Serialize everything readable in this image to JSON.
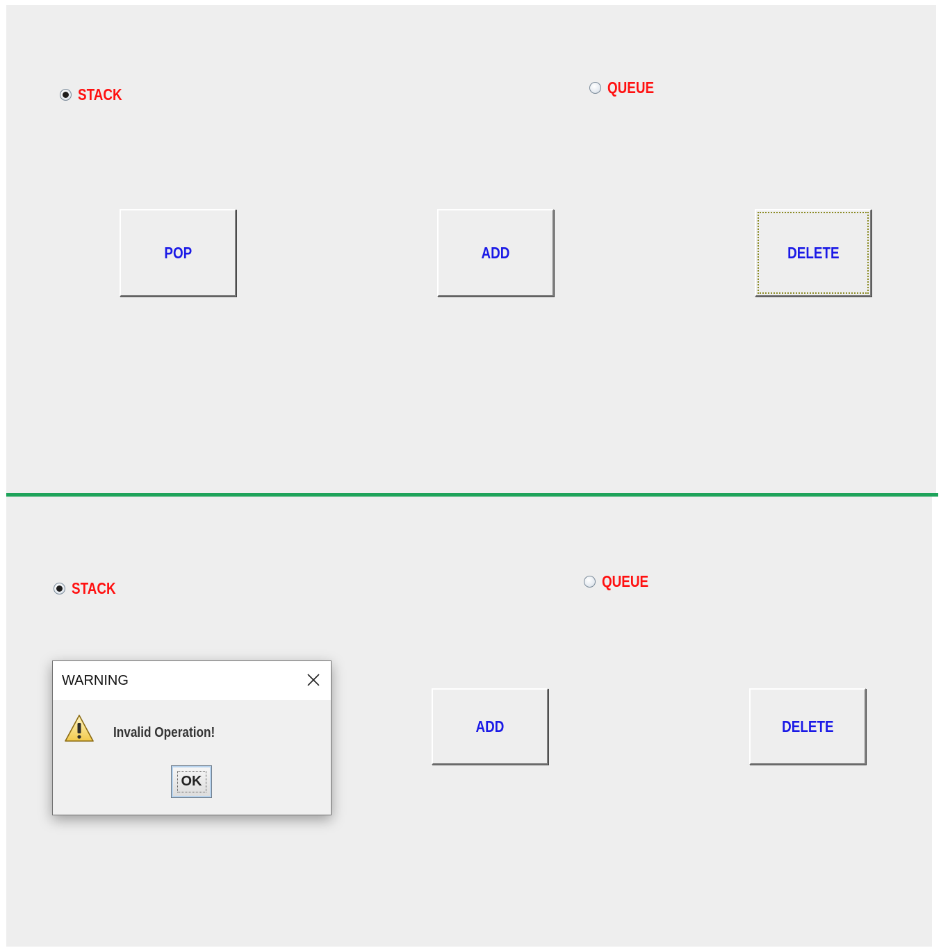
{
  "top_panel": {
    "radio_stack": {
      "label": "STACK",
      "checked": true
    },
    "radio_queue": {
      "label": "QUEUE",
      "checked": false
    },
    "buttons": {
      "pop": "POP",
      "add": "ADD",
      "delete": "DELETE"
    },
    "focused_button": "DELETE"
  },
  "bottom_panel": {
    "radio_stack": {
      "label": "STACK",
      "checked": true
    },
    "radio_queue": {
      "label": "QUEUE",
      "checked": false
    },
    "buttons": {
      "add": "ADD",
      "delete": "DELETE"
    }
  },
  "dialog": {
    "title": "WARNING",
    "message": "Invalid Operation!",
    "ok_label": "OK",
    "icon": "warning-icon"
  },
  "colors": {
    "panel_bg": "#eeeeee",
    "radio_label": "#ff1010",
    "button_label": "#1a19e6",
    "divider": "#1ea35a"
  }
}
